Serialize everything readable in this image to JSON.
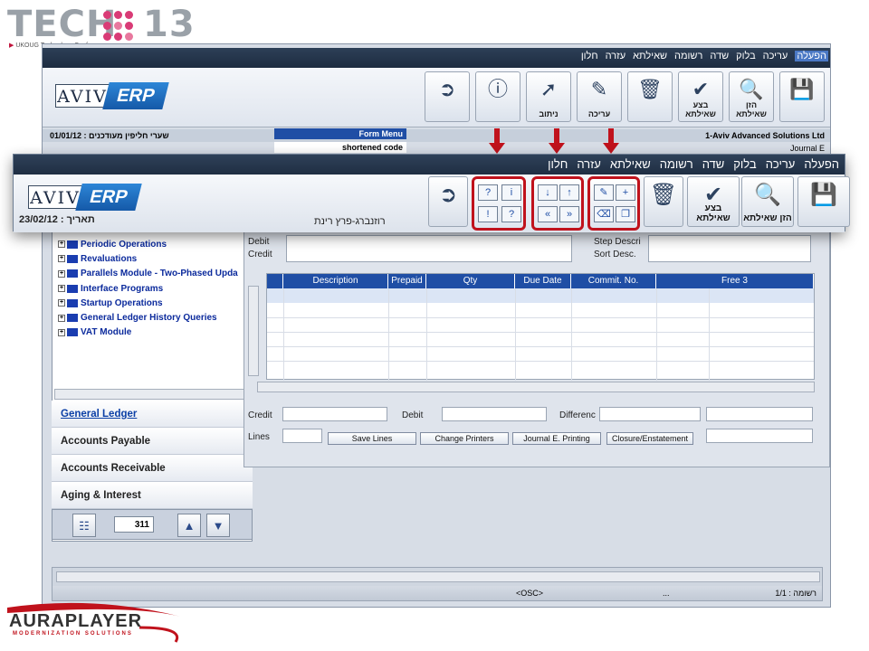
{
  "branding": {
    "tech13_text": "TECH",
    "tech13_number": "13",
    "tech13_subtitle": "UKOUG Technology Conference",
    "auraplayer_name": "AURAPLAYER",
    "auraplayer_tagline": "MODERNIZATION SOLUTIONS"
  },
  "app": {
    "logo_left": "AVIV",
    "logo_right": "ERP",
    "menu": [
      "הפעלה",
      "עריכה",
      "בלוק",
      "שדה",
      "רשומה",
      "שאילתא",
      "עזרה",
      "חלון"
    ],
    "overlay_menu": [
      "הפעלה",
      "עריכה",
      "בלוק",
      "שדה",
      "רשומה",
      "שאילתא",
      "עזרה",
      "חלון"
    ]
  },
  "toolbar": {
    "save_label": "",
    "query_enter_label": "הזן שאילתא",
    "query_execute_label": "בצע שאילתא",
    "delete_label": "",
    "edit_label": "עריכה",
    "navigate_label": "ניתוב",
    "info_label": "",
    "exit_label": ""
  },
  "infobar": {
    "date_left": "01/01/12 : שערי חליפין מעודכנים",
    "company": "1-Aviv Advanced Solutions Ltd",
    "form_menu": "Form Menu",
    "shortened_code": "shortened code",
    "journal": "Journal E"
  },
  "overlay": {
    "date_label": "23/02/12 : תאריך",
    "user_name": "רוזנברג-פרץ רינת"
  },
  "tree": {
    "items": [
      "Periodic Operations",
      "Revaluations",
      "Parallels Module - Two-Phased Upda",
      "Interface Programs",
      "Startup Operations",
      "General Ledger History Queries",
      "VAT Module"
    ]
  },
  "modules": {
    "items": [
      "General Ledger",
      "Accounts Payable",
      "Accounts Receivable",
      "Aging & Interest"
    ],
    "active": "General Ledger"
  },
  "pager": {
    "value": "311"
  },
  "form": {
    "debit_label": "Debit",
    "credit_label": "Credit",
    "step_label": "Step  Descri",
    "sort_label": "Sort Desc.",
    "columns": [
      "Description",
      "Prepaid",
      "Qty",
      "Due Date",
      "Commit. No.",
      "Free 3"
    ],
    "bottom_credit": "Credit",
    "bottom_debit": "Debit",
    "bottom_difference": "Differenc",
    "lines_label": "Lines",
    "buttons": [
      "Save Lines",
      "Change Printers",
      "Journal E. Printing",
      "Closure/Enstatement"
    ]
  },
  "status": {
    "osc": "<OSC>",
    "ellipsis": "...",
    "record": "רשומה : 1/1"
  },
  "colors": {
    "highlight": "#c0121c",
    "menubar": "#1f2e43",
    "grid_header": "#1f4ea5",
    "link_blue": "#0b2a9c"
  }
}
